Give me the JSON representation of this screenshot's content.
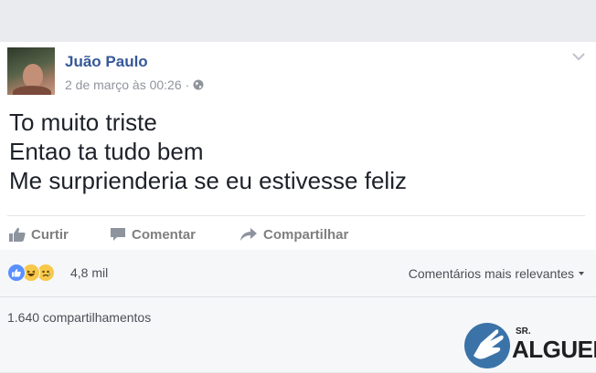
{
  "post": {
    "author": "Juão Paulo",
    "timestamp": "2 de março às 00:26",
    "separator": "·",
    "privacy_icon": "globe-icon",
    "menu_icon": "chevron-down-icon",
    "lines": [
      "To muito triste",
      "Entao ta tudo bem",
      "Me surprienderia se eu estivesse feliz"
    ]
  },
  "actions": {
    "like": {
      "label": "Curtir",
      "icon": "thumbs-up-icon"
    },
    "comment": {
      "label": "Comentar",
      "icon": "comment-icon"
    },
    "share": {
      "label": "Compartilhar",
      "icon": "share-icon"
    }
  },
  "stats": {
    "reactions": [
      "like",
      "haha",
      "sad"
    ],
    "reaction_count": "4,8 mil",
    "comments_filter": "Comentários mais relevantes",
    "comments_filter_icon": "caret-down-icon",
    "shares": "1.640 compartilhamentos"
  },
  "watermark": {
    "prefix": "SR.",
    "word": "ALGUEM"
  },
  "colors": {
    "page_bg": "#e9ebee",
    "link": "#365899",
    "muted": "#90949c",
    "like_blue": "#5890ff",
    "emoji_yellow": "#f7c84a"
  }
}
